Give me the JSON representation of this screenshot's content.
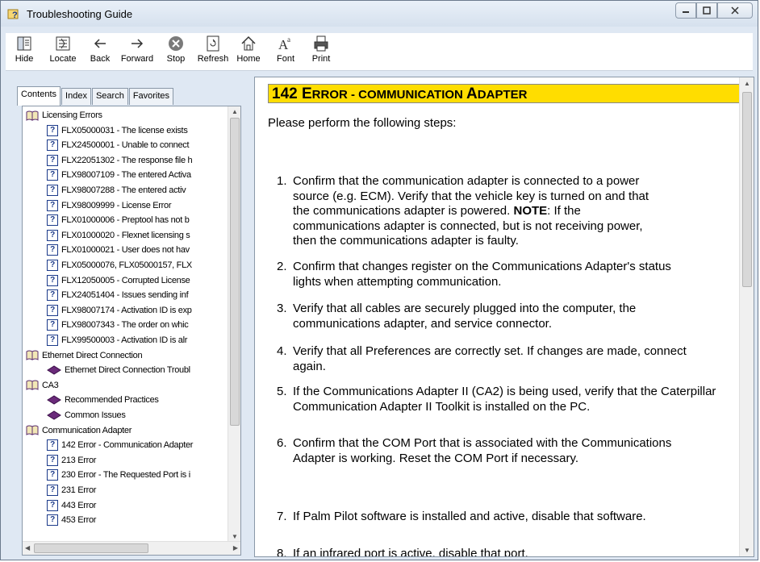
{
  "window": {
    "title": "Troubleshooting Guide"
  },
  "toolbar": {
    "buttons": [
      {
        "label": "Hide",
        "icon": "hide-icon"
      },
      {
        "label": "Locate",
        "icon": "locate-icon"
      },
      {
        "label": "Back",
        "icon": "back-arrow-icon"
      },
      {
        "label": "Forward",
        "icon": "forward-arrow-icon"
      },
      {
        "label": "Stop",
        "icon": "stop-icon"
      },
      {
        "label": "Refresh",
        "icon": "refresh-icon"
      },
      {
        "label": "Home",
        "icon": "home-icon"
      },
      {
        "label": "Font",
        "icon": "font-icon"
      },
      {
        "label": "Print",
        "icon": "print-icon"
      }
    ]
  },
  "nav_tabs": [
    "Contents",
    "Index",
    "Search",
    "Favorites"
  ],
  "tree": [
    {
      "type": "book",
      "label": "Licensing Errors",
      "indent": 0
    },
    {
      "type": "topic",
      "label": "FLX05000031 - The license exists",
      "indent": 1
    },
    {
      "type": "topic",
      "label": "FLX24500001 - Unable to connect",
      "indent": 1
    },
    {
      "type": "topic",
      "label": "FLX22051302 - The response file h",
      "indent": 1
    },
    {
      "type": "topic",
      "label": "FLX98007109 - The entered Activa",
      "indent": 1
    },
    {
      "type": "topic",
      "label": "FLX98007288 - The entered activ",
      "indent": 1
    },
    {
      "type": "topic",
      "label": "FLX98009999 - License Error",
      "indent": 1
    },
    {
      "type": "topic",
      "label": "FLX01000006 - Preptool has not b",
      "indent": 1
    },
    {
      "type": "topic",
      "label": "FLX01000020 - Flexnet licensing s",
      "indent": 1
    },
    {
      "type": "topic",
      "label": "FLX01000021 - User does not hav",
      "indent": 1
    },
    {
      "type": "topic",
      "label": "FLX05000076, FLX05000157, FLX",
      "indent": 1
    },
    {
      "type": "topic",
      "label": "FLX12050005 - Corrupted License",
      "indent": 1
    },
    {
      "type": "topic",
      "label": "FLX24051404 - Issues sending inf",
      "indent": 1
    },
    {
      "type": "topic",
      "label": "FLX98007174 - Activation ID is exp",
      "indent": 1
    },
    {
      "type": "topic",
      "label": "FLX98007343 - The order on whic",
      "indent": 1
    },
    {
      "type": "topic",
      "label": "FLX99500003 - Activation ID is alr",
      "indent": 1
    },
    {
      "type": "book",
      "label": "Ethernet Direct Connection",
      "indent": 0
    },
    {
      "type": "page",
      "label": "Ethernet Direct Connection Troubl",
      "indent": 1
    },
    {
      "type": "book",
      "label": "CA3",
      "indent": 0
    },
    {
      "type": "page",
      "label": "Recommended Practices",
      "indent": 1
    },
    {
      "type": "page",
      "label": "Common Issues",
      "indent": 1
    },
    {
      "type": "book",
      "label": "Communication Adapter",
      "indent": 0
    },
    {
      "type": "topic",
      "label": "142 Error - Communication Adapter",
      "indent": 1
    },
    {
      "type": "topic",
      "label": "213 Error",
      "indent": 1
    },
    {
      "type": "topic",
      "label": "230 Error - The Requested Port is i",
      "indent": 1
    },
    {
      "type": "topic",
      "label": "231 Error",
      "indent": 1
    },
    {
      "type": "topic",
      "label": "443 Error",
      "indent": 1
    },
    {
      "type": "topic",
      "label": "453 Error",
      "indent": 1
    }
  ],
  "content": {
    "heading_big": [
      "1",
      "42 E",
      "RROR - C",
      "OMMUNICATION ",
      "A",
      "DAPTER"
    ],
    "intro": "Please perform the following steps:",
    "steps": [
      {
        "num": "1.",
        "lines": [
          "Confirm that the communication adapter is connected to a power",
          "source (e.g. ECM). Verify that the vehicle key is turned on and that",
          "the communications adapter is powered. ",
          "communications adapter is connected, but is not receiving power,",
          "then the communications adapter is faulty."
        ],
        "note_label": "NOTE",
        "note_after": ": If the"
      },
      {
        "num": "2.",
        "text": "Confirm that changes register on the Communications Adapter's status lights when attempting communication."
      },
      {
        "num": "3.",
        "text": "Verify that all cables are securely plugged into the computer, the communications adapter, and service connector."
      },
      {
        "num": "4.",
        "text": "Verify that all Preferences are correctly set. If changes are made, connect again."
      },
      {
        "num": "5.",
        "text": "If the Communications Adapter II (CA2) is being used, verify that the Caterpillar Communication Adapter II Toolkit is installed on the PC."
      },
      {
        "num": "6.",
        "text": "Confirm that the COM Port that is associated with the Communications Adapter is working. Reset the COM Port if necessary."
      },
      {
        "num": "7.",
        "text": "If Palm Pilot software is installed and active, disable that software."
      },
      {
        "num": "8.",
        "text": "If an infrared port is active, disable that port."
      }
    ]
  }
}
